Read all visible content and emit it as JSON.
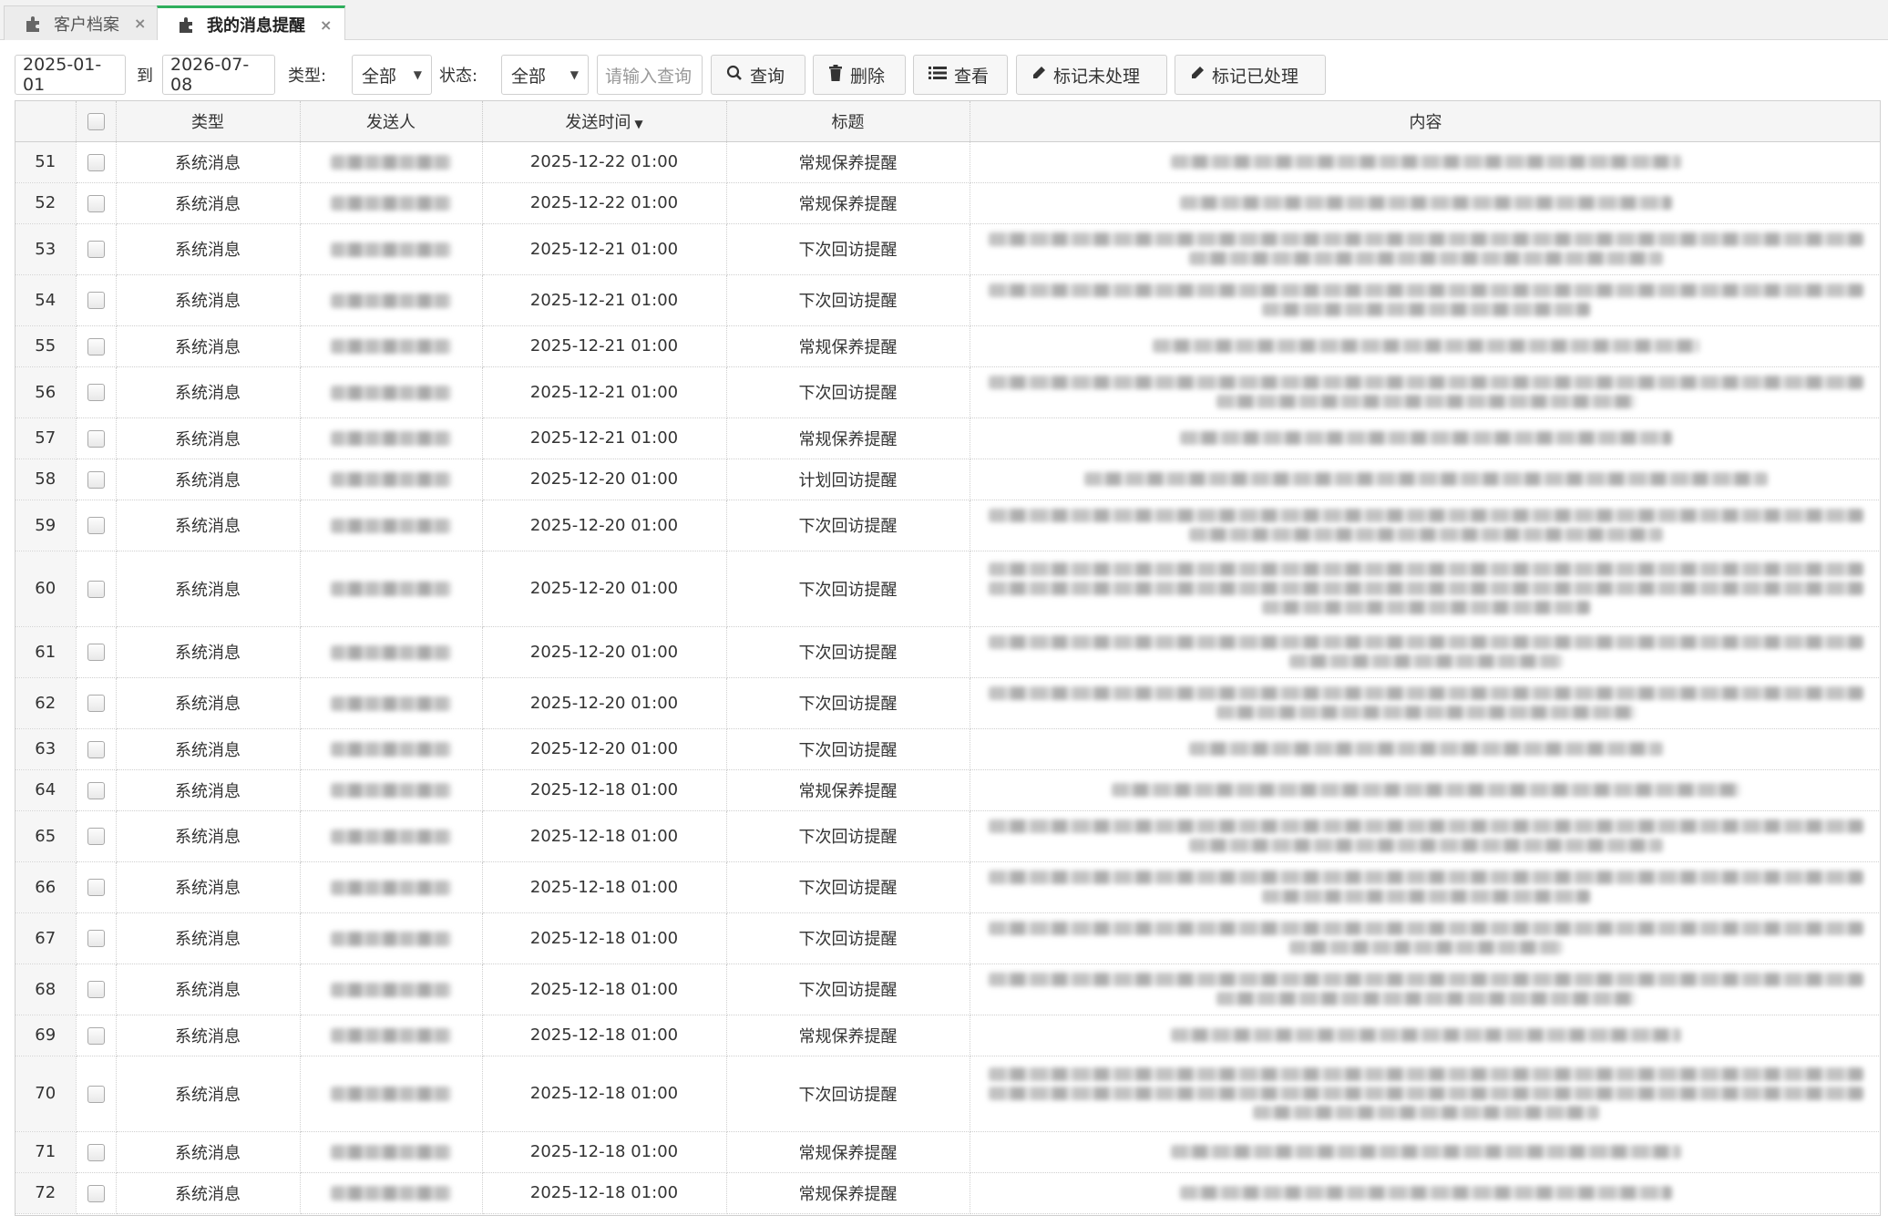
{
  "tabs": [
    {
      "label": "客户档案",
      "active": false
    },
    {
      "label": "我的消息提醒",
      "active": true
    }
  ],
  "toolbar": {
    "date_from": "2025-01-01",
    "to_label": "到",
    "date_to": "2026-07-08",
    "type_label": "类型:",
    "type_value": "全部",
    "status_label": "状态:",
    "status_value": "全部",
    "search_placeholder": "请输入查询",
    "query_label": "查询",
    "delete_label": "删除",
    "view_label": "查看",
    "mark_unprocessed_label": "标记未处理",
    "mark_processed_label": "标记已处理"
  },
  "table": {
    "headers": {
      "type": "类型",
      "sender": "发送人",
      "send_time": "发送时间",
      "title": "标题",
      "content": "内容"
    },
    "rows": [
      {
        "num": "51",
        "type": "系统消息",
        "time": "2025-12-22 01:00",
        "title": "常规保养提醒",
        "lines": 1
      },
      {
        "num": "52",
        "type": "系统消息",
        "time": "2025-12-22 01:00",
        "title": "常规保养提醒",
        "lines": 1
      },
      {
        "num": "53",
        "type": "系统消息",
        "time": "2025-12-21 01:00",
        "title": "下次回访提醒",
        "lines": 2
      },
      {
        "num": "54",
        "type": "系统消息",
        "time": "2025-12-21 01:00",
        "title": "下次回访提醒",
        "lines": 2
      },
      {
        "num": "55",
        "type": "系统消息",
        "time": "2025-12-21 01:00",
        "title": "常规保养提醒",
        "lines": 1
      },
      {
        "num": "56",
        "type": "系统消息",
        "time": "2025-12-21 01:00",
        "title": "下次回访提醒",
        "lines": 2
      },
      {
        "num": "57",
        "type": "系统消息",
        "time": "2025-12-21 01:00",
        "title": "常规保养提醒",
        "lines": 1
      },
      {
        "num": "58",
        "type": "系统消息",
        "time": "2025-12-20 01:00",
        "title": "计划回访提醒",
        "lines": 1
      },
      {
        "num": "59",
        "type": "系统消息",
        "time": "2025-12-20 01:00",
        "title": "下次回访提醒",
        "lines": 2
      },
      {
        "num": "60",
        "type": "系统消息",
        "time": "2025-12-20 01:00",
        "title": "下次回访提醒",
        "lines": 3
      },
      {
        "num": "61",
        "type": "系统消息",
        "time": "2025-12-20 01:00",
        "title": "下次回访提醒",
        "lines": 2
      },
      {
        "num": "62",
        "type": "系统消息",
        "time": "2025-12-20 01:00",
        "title": "下次回访提醒",
        "lines": 2
      },
      {
        "num": "63",
        "type": "系统消息",
        "time": "2025-12-20 01:00",
        "title": "下次回访提醒",
        "lines": 1
      },
      {
        "num": "64",
        "type": "系统消息",
        "time": "2025-12-18 01:00",
        "title": "常规保养提醒",
        "lines": 1
      },
      {
        "num": "65",
        "type": "系统消息",
        "time": "2025-12-18 01:00",
        "title": "下次回访提醒",
        "lines": 2
      },
      {
        "num": "66",
        "type": "系统消息",
        "time": "2025-12-18 01:00",
        "title": "下次回访提醒",
        "lines": 2
      },
      {
        "num": "67",
        "type": "系统消息",
        "time": "2025-12-18 01:00",
        "title": "下次回访提醒",
        "lines": 2
      },
      {
        "num": "68",
        "type": "系统消息",
        "time": "2025-12-18 01:00",
        "title": "下次回访提醒",
        "lines": 2
      },
      {
        "num": "69",
        "type": "系统消息",
        "time": "2025-12-18 01:00",
        "title": "常规保养提醒",
        "lines": 1
      },
      {
        "num": "70",
        "type": "系统消息",
        "time": "2025-12-18 01:00",
        "title": "下次回访提醒",
        "lines": 3
      },
      {
        "num": "71",
        "type": "系统消息",
        "time": "2025-12-18 01:00",
        "title": "常规保养提醒",
        "lines": 1
      },
      {
        "num": "72",
        "type": "系统消息",
        "time": "2025-12-18 01:00",
        "title": "常规保养提醒",
        "lines": 1
      }
    ]
  },
  "colors": {
    "tab_accent": "#2eae5c"
  }
}
